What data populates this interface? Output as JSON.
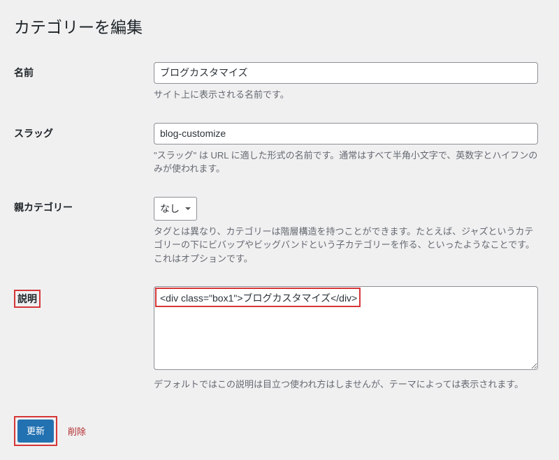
{
  "page_title": "カテゴリーを編集",
  "fields": {
    "name": {
      "label": "名前",
      "value": "ブログカスタマイズ",
      "description": "サイト上に表示される名前です。"
    },
    "slug": {
      "label": "スラッグ",
      "value": "blog-customize",
      "description": "\"スラッグ\" は URL に適した形式の名前です。通常はすべて半角小文字で、英数字とハイフンのみが使われます。"
    },
    "parent": {
      "label": "親カテゴリー",
      "value": "なし",
      "description": "タグとは異なり、カテゴリーは階層構造を持つことができます。たとえば、ジャズというカテゴリーの下にビバップやビッグバンドという子カテゴリーを作る、といったようなことです。これはオプションです。"
    },
    "description": {
      "label": "説明",
      "value": "<div class=\"box1\">ブログカスタマイズ</div>",
      "description": "デフォルトではこの説明は目立つ使われ方はしませんが、テーマによっては表示されます。"
    }
  },
  "actions": {
    "update": "更新",
    "delete": "削除"
  }
}
